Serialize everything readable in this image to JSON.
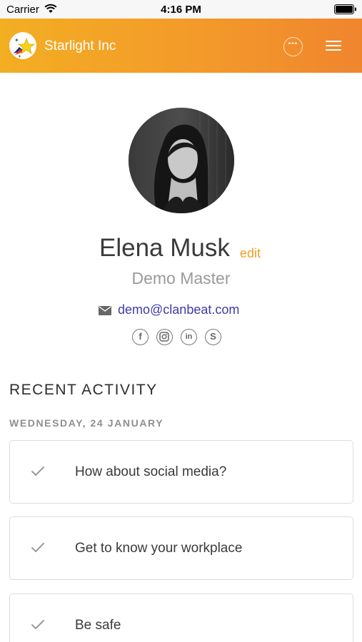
{
  "status_bar": {
    "carrier": "Carrier",
    "time": "4:16 PM"
  },
  "header": {
    "title": "Starlight Inc"
  },
  "profile": {
    "name": "Elena Musk",
    "edit_label": "edit",
    "role": "Demo Master",
    "email": "demo@clanbeat.com",
    "social": [
      "facebook-icon",
      "instagram-icon",
      "linkedin-icon",
      "skype-icon"
    ]
  },
  "activity": {
    "section_title": "RECENT ACTIVITY",
    "date_heading": "WEDNESDAY, 24 JANUARY",
    "items": [
      {
        "label": "How about social media?"
      },
      {
        "label": "Get to know your workplace"
      },
      {
        "label": "Be safe"
      }
    ]
  },
  "colors": {
    "accent": "#f39c26",
    "link": "#3f3aa6",
    "header_start": "#f3ae22",
    "header_end": "#f0852e"
  }
}
